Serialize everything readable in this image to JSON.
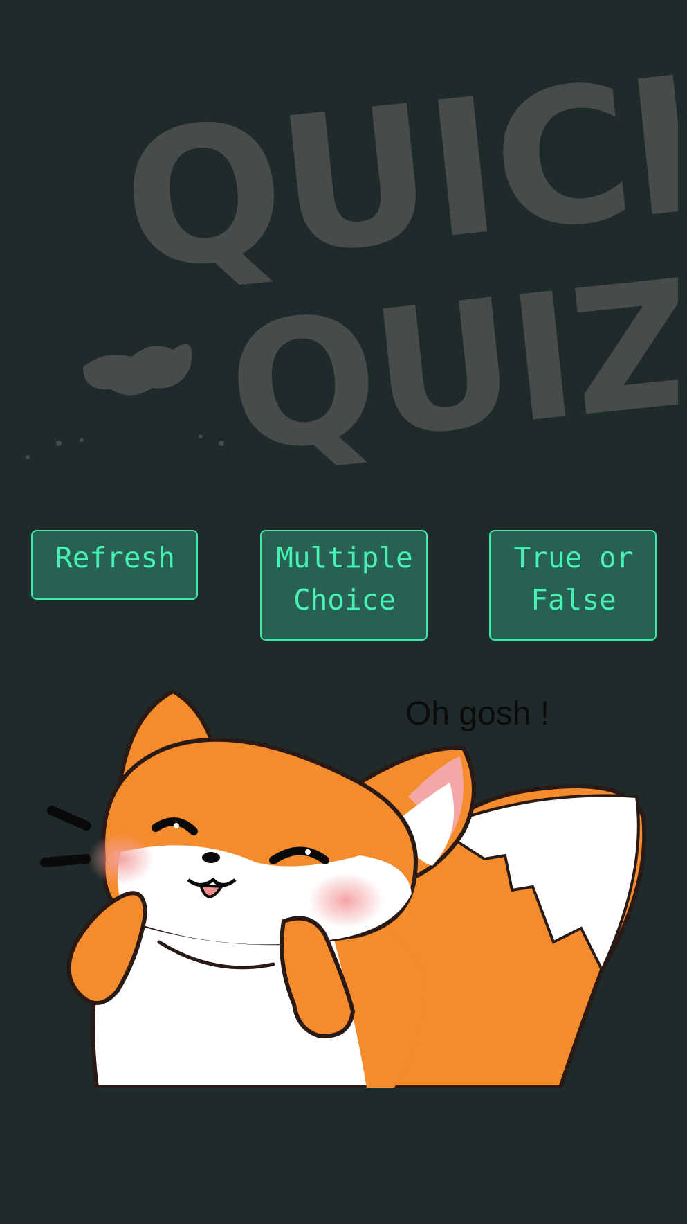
{
  "app": {
    "logo_text": [
      "QUICK",
      "QUIZ"
    ],
    "logo_color": "#474b4a"
  },
  "buttons": {
    "refresh_label": "Refresh",
    "multiple_choice_label": "Multiple\nChoice",
    "true_false_label": "True or\nFalse"
  },
  "mascot": {
    "speech_text": "Oh gosh !",
    "icon": "fox-mascot-icon"
  },
  "colors": {
    "background": "#1f2a2a",
    "button_fill": "#266151",
    "button_border": "#3ee8a8",
    "button_text": "#49f0b5",
    "fox_orange": "#f48b2d"
  }
}
